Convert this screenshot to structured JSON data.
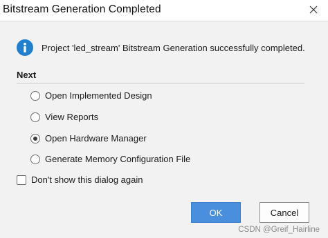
{
  "window": {
    "title": "Bitstream Generation Completed",
    "close_icon": "close-icon"
  },
  "message": {
    "icon": "info-icon",
    "icon_color": "#1f7fd0",
    "text": "Project 'led_stream' Bitstream Generation successfully completed."
  },
  "section": {
    "label": "Next"
  },
  "options": [
    {
      "label": "Open Implemented Design",
      "selected": false
    },
    {
      "label": "View Reports",
      "selected": false
    },
    {
      "label": "Open Hardware Manager",
      "selected": true
    },
    {
      "label": "Generate Memory Configuration File",
      "selected": false
    }
  ],
  "checkbox": {
    "label": "Don't show this dialog again",
    "checked": false
  },
  "buttons": {
    "ok_label": "OK",
    "cancel_label": "Cancel"
  },
  "watermark": "CSDN @Greif_Hairline",
  "colors": {
    "accent": "#4a8fdd",
    "dialog_background": "#f2f2f2"
  }
}
